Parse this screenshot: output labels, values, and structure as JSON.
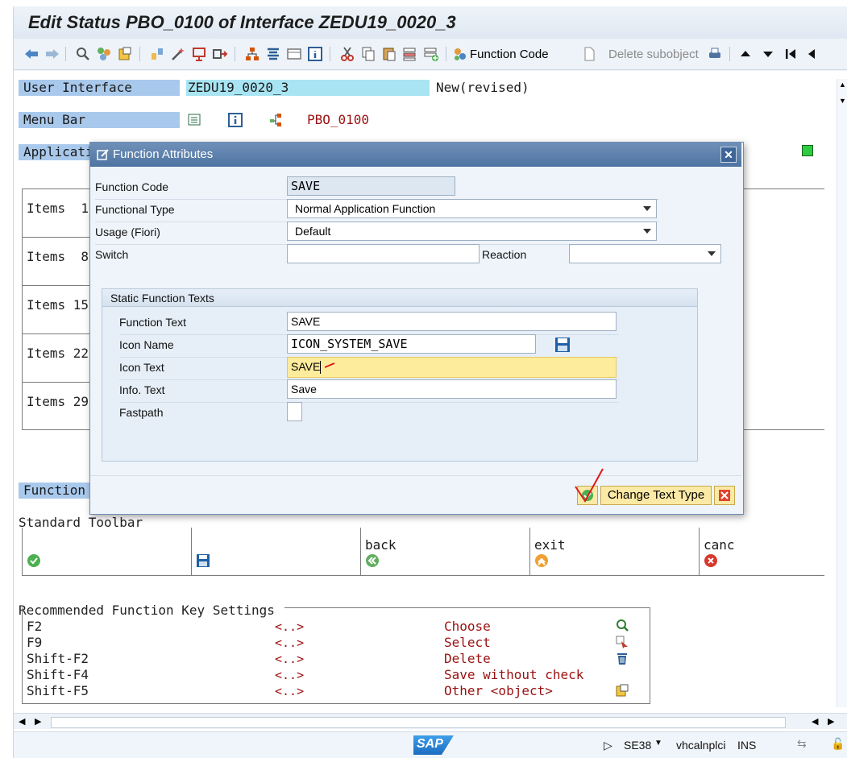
{
  "window": {
    "title": "Edit Status PBO_0100 of Interface ZEDU19_0020_3"
  },
  "toolbar": {
    "function_code_label": "Function Code",
    "delete_subobject_label": "Delete subobject"
  },
  "header": {
    "user_interface_label": "User Interface",
    "user_interface_value": "ZEDU19_0020_3",
    "user_interface_status": "New(revised)",
    "menu_bar_label": "Menu Bar",
    "menu_bar_value": "PBO_0100",
    "application_label": "Applicati",
    "function_label": "Function"
  },
  "items_rows": [
    "Items  1",
    "Items  8",
    "Items 15",
    "Items 22",
    "Items 29"
  ],
  "standard_toolbar": {
    "label": "Standard Toolbar",
    "cells": [
      {
        "text": "",
        "icon": "check-icon"
      },
      {
        "text": "",
        "icon": "save-icon"
      },
      {
        "text": "back",
        "icon": "back-icon"
      },
      {
        "text": "exit",
        "icon": "exit-icon"
      },
      {
        "text": "canc",
        "icon": "cancel-icon"
      }
    ]
  },
  "recommended_keys": {
    "label": "Recommended Function Key Settings",
    "rows": [
      {
        "key": "F2",
        "code": "<..>",
        "text": "Choose",
        "icon": "choose-icon"
      },
      {
        "key": "F9",
        "code": "<..>",
        "text": "Select",
        "icon": "select-icon"
      },
      {
        "key": "Shift-F2",
        "code": "<..>",
        "text": "Delete",
        "icon": "trash-icon"
      },
      {
        "key": "Shift-F4",
        "code": "<..>",
        "text": "Save without check",
        "icon": ""
      },
      {
        "key": "Shift-F5",
        "code": "<..>",
        "text": "Other <object>",
        "icon": "other-object-icon"
      }
    ]
  },
  "dialog": {
    "title": "Function Attributes",
    "function_code_label": "Function Code",
    "function_code_value": "SAVE",
    "functional_type_label": "Functional Type",
    "functional_type_value": "Normal Application Function",
    "usage_label": "Usage (Fiori)",
    "usage_value": "Default",
    "switch_label": "Switch",
    "switch_value": "",
    "reaction_label": "Reaction",
    "reaction_value": "",
    "static_texts_title": "Static Function Texts",
    "function_text_label": "Function Text",
    "function_text_value": "SAVE",
    "icon_name_label": "Icon Name",
    "icon_name_value": "ICON_SYSTEM_SAVE",
    "icon_text_label": "Icon Text",
    "icon_text_value": "SAVE",
    "info_text_label": "Info. Text",
    "info_text_value": "Save",
    "fastpath_label": "Fastpath",
    "fastpath_value": "",
    "change_text_type_label": "Change Text Type"
  },
  "statusbar": {
    "brand": "SAP",
    "transaction": "SE38",
    "server": "vhcalnplci",
    "mode": "INS"
  },
  "colors": {
    "label_blue": "#a9c9ec",
    "field_cyan": "#a8e4f2",
    "dialog_header": "#5a7eab",
    "value_red": "#9a1111",
    "focus_yellow": "#fcec9c"
  }
}
